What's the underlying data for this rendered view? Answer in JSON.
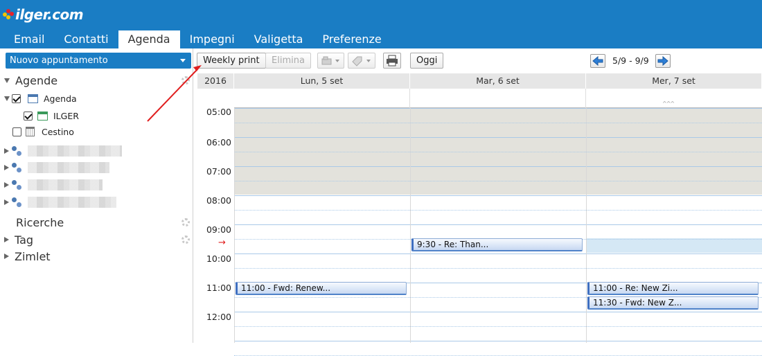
{
  "brand": {
    "logo_text": "ilger.com"
  },
  "tabs": [
    {
      "label": "Email",
      "active": false
    },
    {
      "label": "Contatti",
      "active": false
    },
    {
      "label": "Agenda",
      "active": true
    },
    {
      "label": "Impegni",
      "active": false
    },
    {
      "label": "Valigetta",
      "active": false
    },
    {
      "label": "Preferenze",
      "active": false
    }
  ],
  "sidebar": {
    "new_button": "Nuovo appuntamento",
    "agende_label": "Agende",
    "calendars": [
      {
        "name": "Agenda",
        "checked": true
      },
      {
        "name": "ILGER",
        "checked": true
      },
      {
        "name": "Cestino",
        "checked": false
      }
    ],
    "shared_count": 4,
    "ricerche_label": "Ricerche",
    "tag_label": "Tag",
    "zimlet_label": "Zimlet"
  },
  "toolbar": {
    "weekly_print": "Weekly print",
    "delete": "Elimina",
    "today": "Oggi",
    "range": "5/9 - 9/9"
  },
  "calendar": {
    "year": "2016",
    "days": [
      "Lun, 5 set",
      "Mar, 6 set",
      "Mer, 7 set"
    ],
    "hours": [
      "05:00",
      "06:00",
      "07:00",
      "08:00",
      "09:00",
      "10:00",
      "11:00",
      "12:00"
    ],
    "current_time_marker": "→",
    "more_indicator": "^^^",
    "events": [
      {
        "day": 1,
        "label": "9:30 - Re: Than..."
      },
      {
        "day": 0,
        "label": "11:00 - Fwd: Renew..."
      },
      {
        "day": 2,
        "label": "11:00 - Re: New Zi..."
      },
      {
        "day": 2,
        "label": "11:30 - Fwd: New Z..."
      }
    ]
  },
  "colors": {
    "brand_blue": "#1a7dc4",
    "off_hours": "#e3e2dc",
    "grid_line": "#a9c9e8",
    "selected_slot": "#d5e8f5",
    "annotation_arrow": "#e01e1e"
  }
}
